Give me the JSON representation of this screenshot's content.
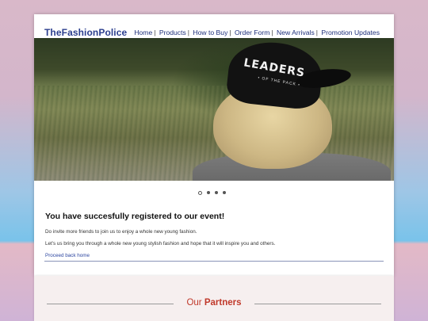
{
  "site": {
    "logo": "TheFashionPolice"
  },
  "nav": [
    "Home",
    "Products",
    "How to Buy",
    "Order Form",
    "New Arrivals",
    "Promotion Updates"
  ],
  "nav_sep": "|",
  "hero": {
    "cap_text": "LEADERS",
    "cap_subtext": "• OF THE PACK •",
    "slides": 4,
    "active_slide": 1
  },
  "message": {
    "heading": "You have succesfully registered to our event!",
    "line1": "Do invite more friends to join us to enjoy a whole new young fashion.",
    "line2": "Let's us bring you through a whole new young stylish fashion and hope that it will inspire you and others.",
    "back_link": "Proceed back home"
  },
  "partners": {
    "prefix": "Our",
    "bold": "Partners"
  },
  "colors": {
    "logo": "#2c3f8f",
    "link": "#2d46a0",
    "partners_accent": "#c0392b"
  }
}
